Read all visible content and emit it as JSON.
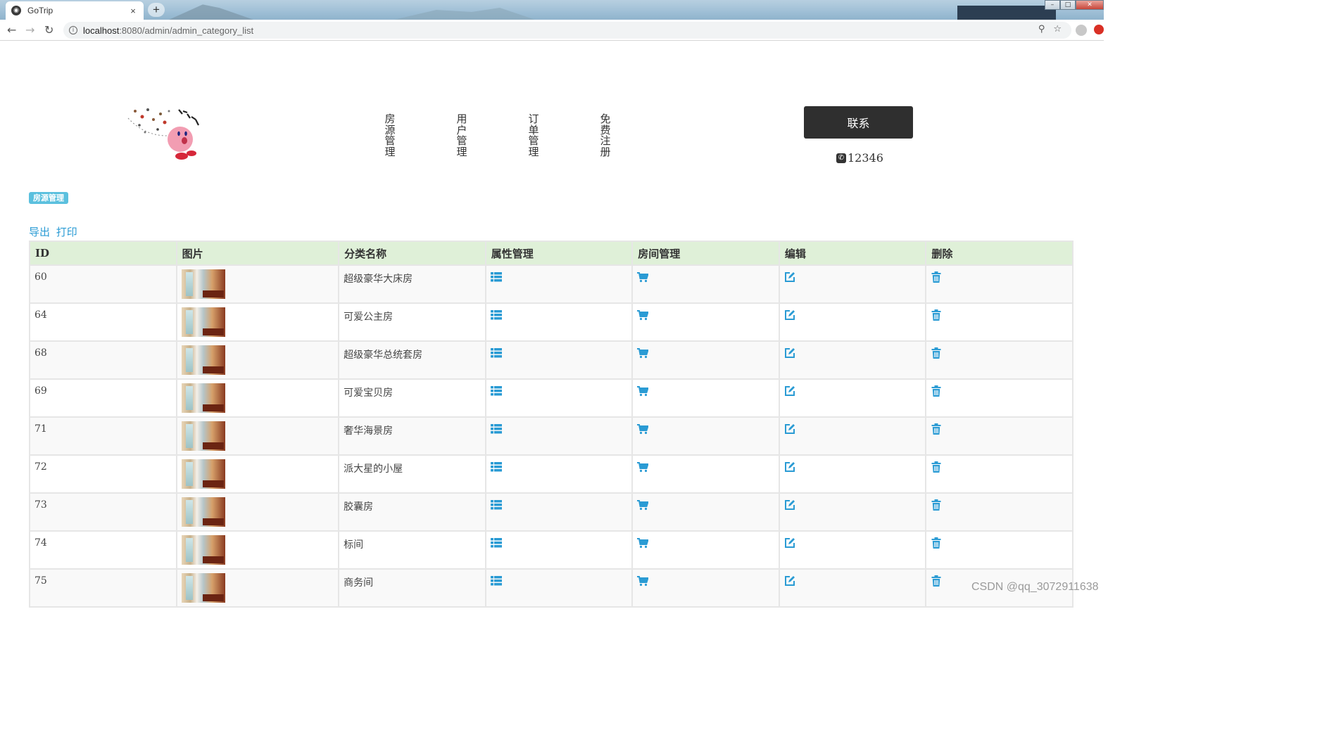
{
  "browser": {
    "tab_title": "GoTrip",
    "tab_close": "×",
    "new_tab": "+",
    "url_host": "localhost",
    "url_path": ":8080/admin/admin_category_list",
    "window_controls": [
      "–",
      "□",
      "✕"
    ]
  },
  "header": {
    "nav_items": [
      {
        "label": "房源管理"
      },
      {
        "label": "用户管理"
      },
      {
        "label": "订单管理"
      },
      {
        "label": "免费注册"
      }
    ],
    "contact_label": "联系",
    "phone": "12346"
  },
  "section_badge": "房源管理",
  "actions": {
    "export": "导出",
    "print": "打印"
  },
  "table": {
    "columns": [
      "ID",
      "图片",
      "分类名称",
      "属性管理",
      "房间管理",
      "编辑",
      "删除"
    ],
    "rows": [
      {
        "id": "60",
        "name": "超级豪华大床房"
      },
      {
        "id": "64",
        "name": "可爱公主房"
      },
      {
        "id": "68",
        "name": "超级豪华总统套房"
      },
      {
        "id": "69",
        "name": "可爱宝贝房"
      },
      {
        "id": "71",
        "name": "奢华海景房"
      },
      {
        "id": "72",
        "name": "派大星的小屋"
      },
      {
        "id": "73",
        "name": "胶囊房"
      },
      {
        "id": "74",
        "name": "标间"
      },
      {
        "id": "75",
        "name": "商务间"
      }
    ]
  },
  "icons": {
    "attribute": "list-icon",
    "room": "cart-icon",
    "edit": "edit-icon",
    "delete": "trash-icon"
  },
  "colors": {
    "accent": "#2a9bd4",
    "header_row": "#dff0d8",
    "badge": "#5bc0de",
    "contact_button": "#2f2f2f"
  },
  "watermark": "CSDN @qq_3072911638"
}
